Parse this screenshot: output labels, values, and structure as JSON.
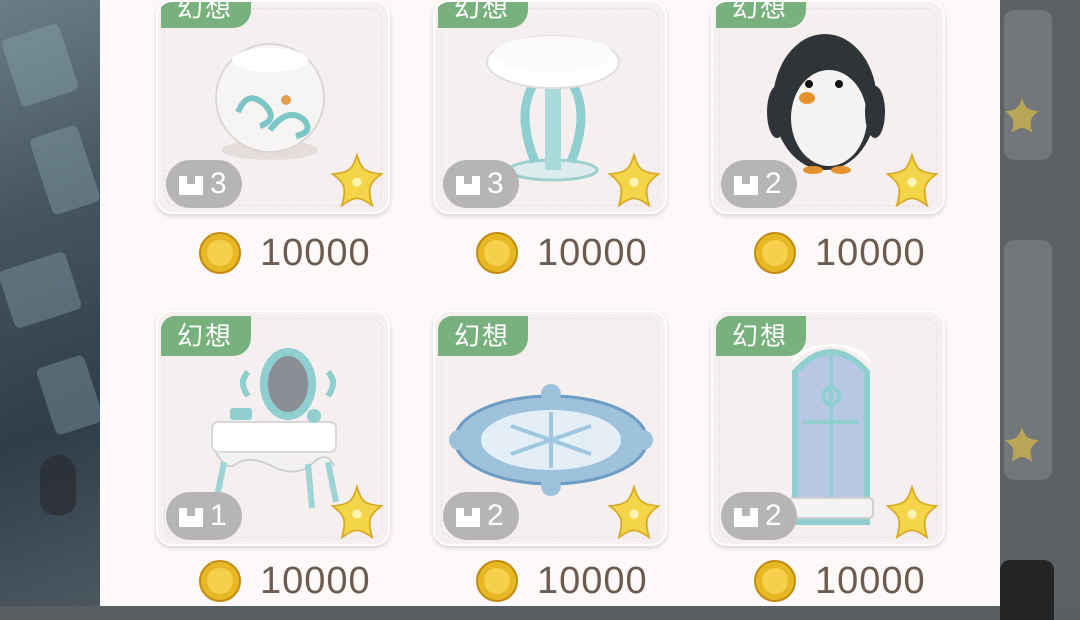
{
  "colors": {
    "panel": "#fcf9f8",
    "tag_green": "#78b17e",
    "quantity_pill": "#b6b4b4",
    "price_text": "#6b5b50",
    "star_gold": "#f4d54a"
  },
  "items": [
    {
      "tag": "幻想",
      "quantity": "3",
      "price": "10000",
      "icon": "snow-vase-icon"
    },
    {
      "tag": "幻想",
      "quantity": "3",
      "price": "10000",
      "icon": "snow-stool-icon"
    },
    {
      "tag": "幻想",
      "quantity": "2",
      "price": "10000",
      "icon": "penguin-icon"
    },
    {
      "tag": "幻想",
      "quantity": "1",
      "price": "10000",
      "icon": "snow-vanity-table-icon"
    },
    {
      "tag": "幻想",
      "quantity": "2",
      "price": "10000",
      "icon": "snowflake-rug-icon"
    },
    {
      "tag": "幻想",
      "quantity": "2",
      "price": "10000",
      "icon": "ice-window-icon"
    }
  ]
}
